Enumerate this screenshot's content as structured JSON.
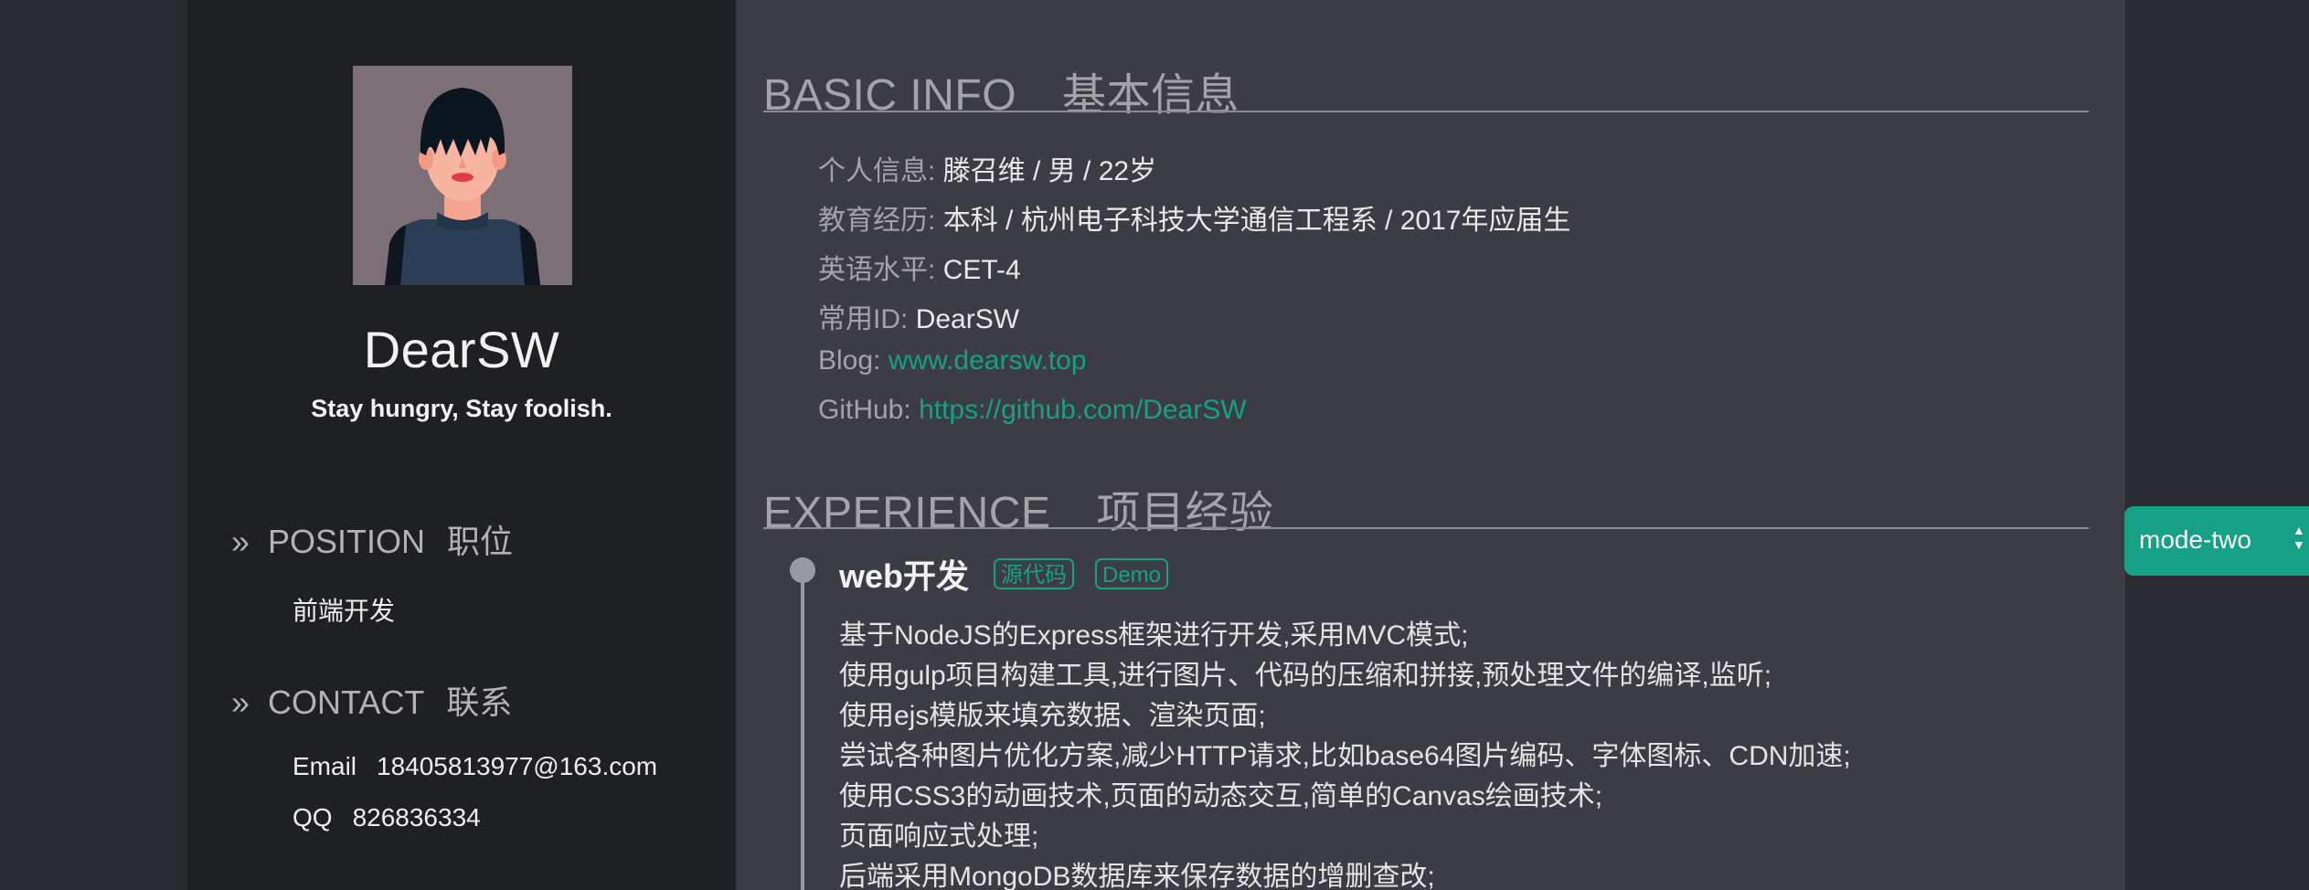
{
  "sidebar": {
    "name": "DearSW",
    "motto": "Stay hungry, Stay foolish.",
    "position": {
      "heading_en": "POSITION",
      "heading_cn": "职位",
      "value": "前端开发"
    },
    "contact": {
      "heading_en": "CONTACT",
      "heading_cn": "联系",
      "email_label": "Email",
      "email": "18405813977@163.com",
      "qq_label": "QQ",
      "qq": "826836334"
    }
  },
  "basic_info": {
    "title_en": "BASIC INFO",
    "title_cn": "基本信息",
    "items": [
      {
        "label": "个人信息:",
        "value": "滕召维 / 男 / 22岁"
      },
      {
        "label": "教育经历:",
        "value": "本科 / 杭州电子科技大学通信工程系 / 2017年应届生"
      },
      {
        "label": "英语水平:",
        "value": "CET-4"
      },
      {
        "label": "常用ID:",
        "value": "DearSW"
      },
      {
        "label": "Blog:",
        "value": "www.dearsw.top"
      },
      {
        "label": "GitHub:",
        "value": "https://github.com/DearSW"
      }
    ]
  },
  "experience": {
    "title_en": "EXPERIENCE",
    "title_cn": "项目经验",
    "project": {
      "title": "web开发",
      "tag_source": "源代码",
      "tag_demo": "Demo",
      "bullets": [
        "基于NodeJS的Express框架进行开发,采用MVC模式;",
        "使用gulp项目构建工具,进行图片、代码的压缩和拼接,预处理文件的编译,监听;",
        "使用ejs模版来填充数据、渲染页面;",
        "尝试各种图片优化方案,减少HTTP请求,比如base64图片编码、字体图标、CDN加速;",
        "使用CSS3的动画技术,页面的动态交互,简单的Canvas绘画技术;",
        "页面响应式处理;",
        "后端采用MongoDB数据库来保存数据的增删查改;"
      ]
    }
  },
  "mode_select": {
    "value": "mode-two"
  },
  "icons": {
    "section_chevron": "double-chevron-right-icon",
    "select_arrows": "select-updown-icon"
  },
  "colors": {
    "accent": "#16a085",
    "sidebar_bg": "#1f2024",
    "main_bg": "#3c3d44",
    "page_bg": "#2a2b30"
  }
}
